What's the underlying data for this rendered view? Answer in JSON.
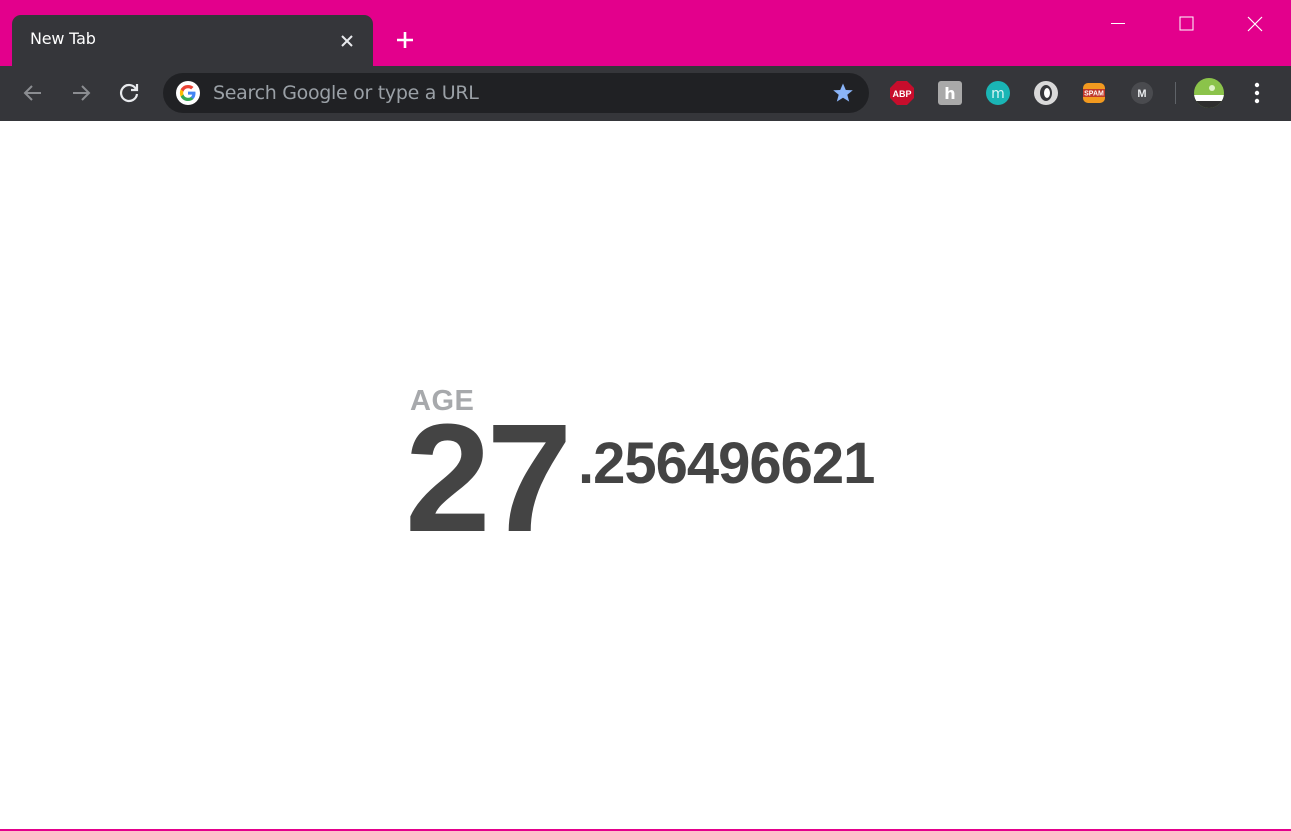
{
  "browser": {
    "tab": {
      "title": "New Tab"
    },
    "omnibox": {
      "placeholder": "Search Google or type a URL"
    },
    "extensions": [
      {
        "name": "adblock-plus-icon",
        "label": "ABP"
      },
      {
        "name": "honey-extension-icon",
        "label": "h"
      },
      {
        "name": "mercury-extension-icon",
        "label": "m"
      },
      {
        "name": "ring-extension-icon",
        "label": ""
      },
      {
        "name": "spam-extension-icon",
        "label": "SPAM"
      },
      {
        "name": "m-extension-icon",
        "label": "M"
      }
    ],
    "colors": {
      "frame": "#e3008c",
      "toolbar": "#35363a",
      "omnibox": "#202124",
      "star": "#8ab4f8"
    }
  },
  "page": {
    "age_label": "AGE",
    "age_integer": "27",
    "age_decimal": ".256496621"
  }
}
